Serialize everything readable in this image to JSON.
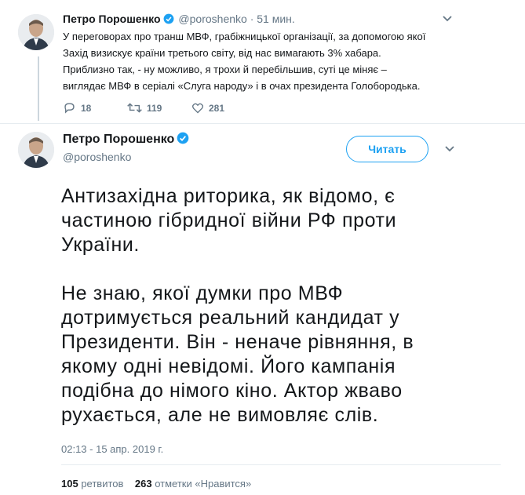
{
  "tweet1": {
    "name": "Петро Порошенко",
    "handle": "@poroshenko",
    "separator": "·",
    "time": "51 мин.",
    "text_lines": [
      "У переговорах про транш МВФ, грабіжницької організації, за допомогою якої",
      "Захід визискує країни третього світу, від нас вимагають 3% хабара.",
      "Приблизно так, - ну можливо, я трохи й перебільшив, суті це міняє –",
      "виглядає МВФ в серіалі «Слуга народу» і в очах президента Голобородька."
    ],
    "replies": "18",
    "retweets": "119",
    "likes": "281"
  },
  "tweet2": {
    "name": "Петро Порошенко",
    "handle": "@poroshenko",
    "follow_label": "Читать",
    "paragraphs": [
      [
        "Антизахідна риторика, як відомо, є",
        "частиною гібридної війни РФ проти",
        "України."
      ],
      [
        "Не знаю, якої думки про МВФ",
        "дотримується реальний кандидат у",
        "Президенти. Він - неначе рівняння, в",
        "якому одні невідомі. Його кампанія",
        "подібна до німого кіно. Актор жваво",
        "рухається, але не вимовляє слів."
      ]
    ],
    "timestamp": "02:13 - 15 апр. 2019 г.",
    "retweet_count": "105",
    "retweet_label": "ретвитов",
    "like_count": "263",
    "like_label": "отметки «Нравится»"
  },
  "icons": {
    "verified": "verified-badge-icon",
    "reply": "reply-icon",
    "retweet": "retweet-icon",
    "like": "heart-icon",
    "more": "chevron-down-icon"
  },
  "colors": {
    "accent": "#1da1f2",
    "muted": "#657786",
    "text": "#14171a"
  }
}
